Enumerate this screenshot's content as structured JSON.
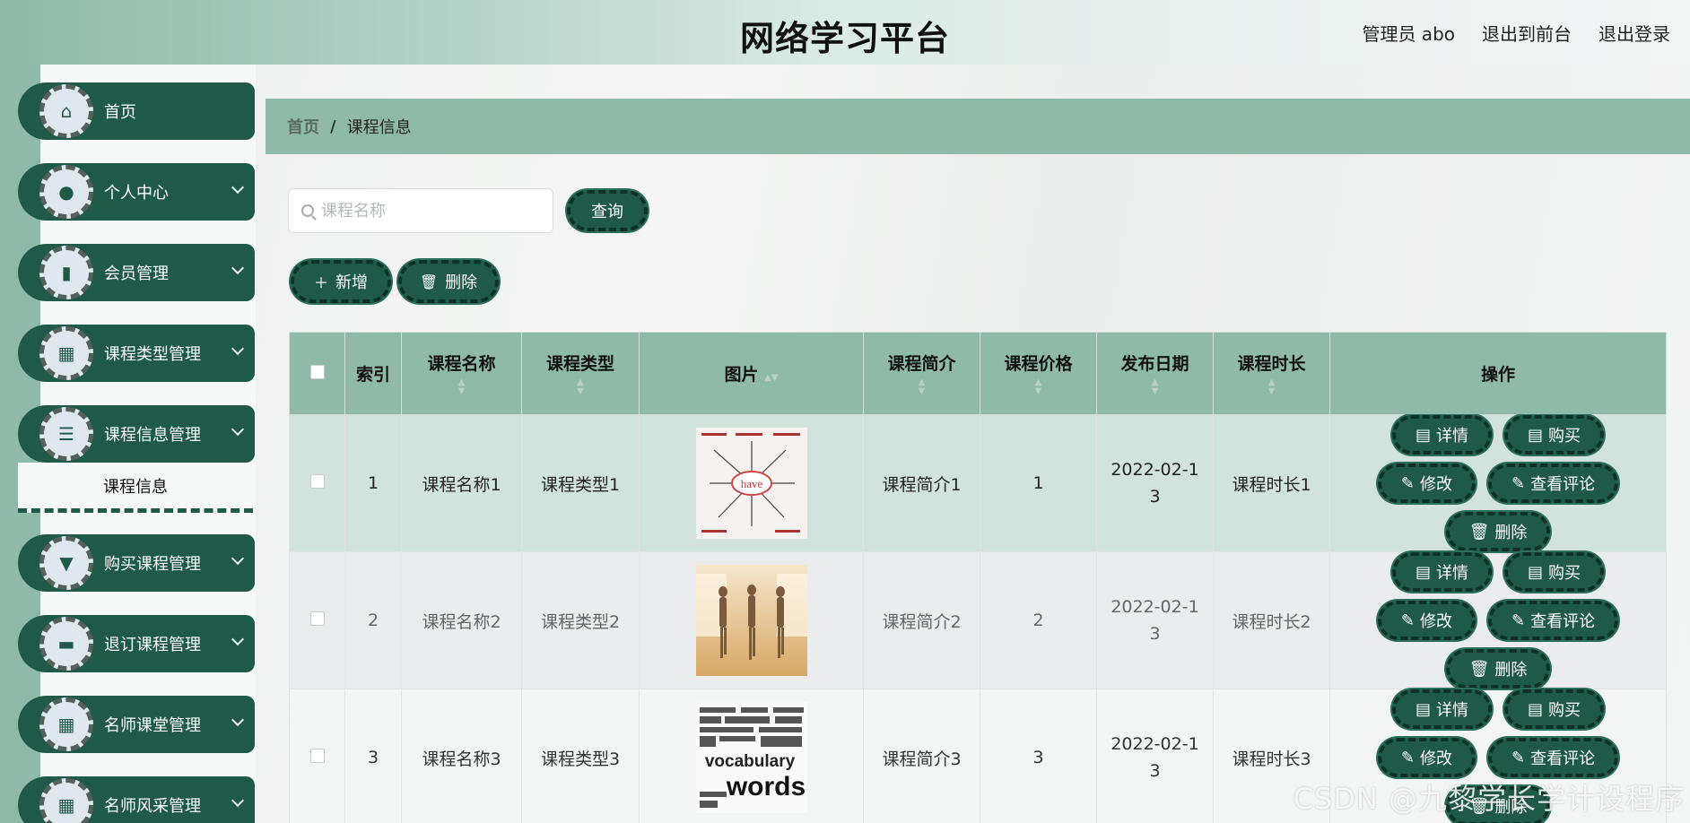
{
  "header": {
    "title": "网络学习平台",
    "user": "管理员 abo",
    "front": "退出到前台",
    "logout": "退出登录"
  },
  "sidebar": {
    "items": [
      {
        "label": "首页",
        "icon": "home-icon"
      },
      {
        "label": "个人中心",
        "icon": "user-icon"
      },
      {
        "label": "会员管理",
        "icon": "book-icon"
      },
      {
        "label": "课程类型管理",
        "icon": "grid-icon"
      },
      {
        "label": "课程信息管理",
        "icon": "list-icon"
      },
      {
        "label": "购买课程管理",
        "icon": "brush-icon"
      },
      {
        "label": "退订课程管理",
        "icon": "briefcase-icon"
      },
      {
        "label": "名师课堂管理",
        "icon": "grid-icon"
      },
      {
        "label": "名师风采管理",
        "icon": "grid-icon"
      }
    ],
    "submenu": "课程信息"
  },
  "breadcrumb": {
    "home": "首页",
    "sep": "/",
    "current": "课程信息"
  },
  "search": {
    "placeholder": "课程名称",
    "button": "查询"
  },
  "actions": {
    "add": "新增",
    "delete": "删除"
  },
  "table": {
    "headers": [
      "索引",
      "课程名称",
      "课程类型",
      "图片",
      "课程简介",
      "课程价格",
      "发布日期",
      "课程时长",
      "操作"
    ],
    "rows": [
      {
        "index": "1",
        "name": "课程名称1",
        "type": "课程类型1",
        "intro": "课程简介1",
        "price": "1",
        "date": "2022-02-13",
        "duration": "课程时长1"
      },
      {
        "index": "2",
        "name": "课程名称2",
        "type": "课程类型2",
        "intro": "课程简介2",
        "price": "2",
        "date": "2022-02-13",
        "duration": "课程时长2"
      },
      {
        "index": "3",
        "name": "课程名称3",
        "type": "课程类型3",
        "intro": "课程简介3",
        "price": "3",
        "date": "2022-02-13",
        "duration": "课程时长3"
      }
    ],
    "ops": {
      "detail": "详情",
      "buy": "购买",
      "edit": "修改",
      "comments": "查看评论",
      "delete": "删除"
    }
  },
  "watermark": "CSDN @九黎学长学计设程序"
}
